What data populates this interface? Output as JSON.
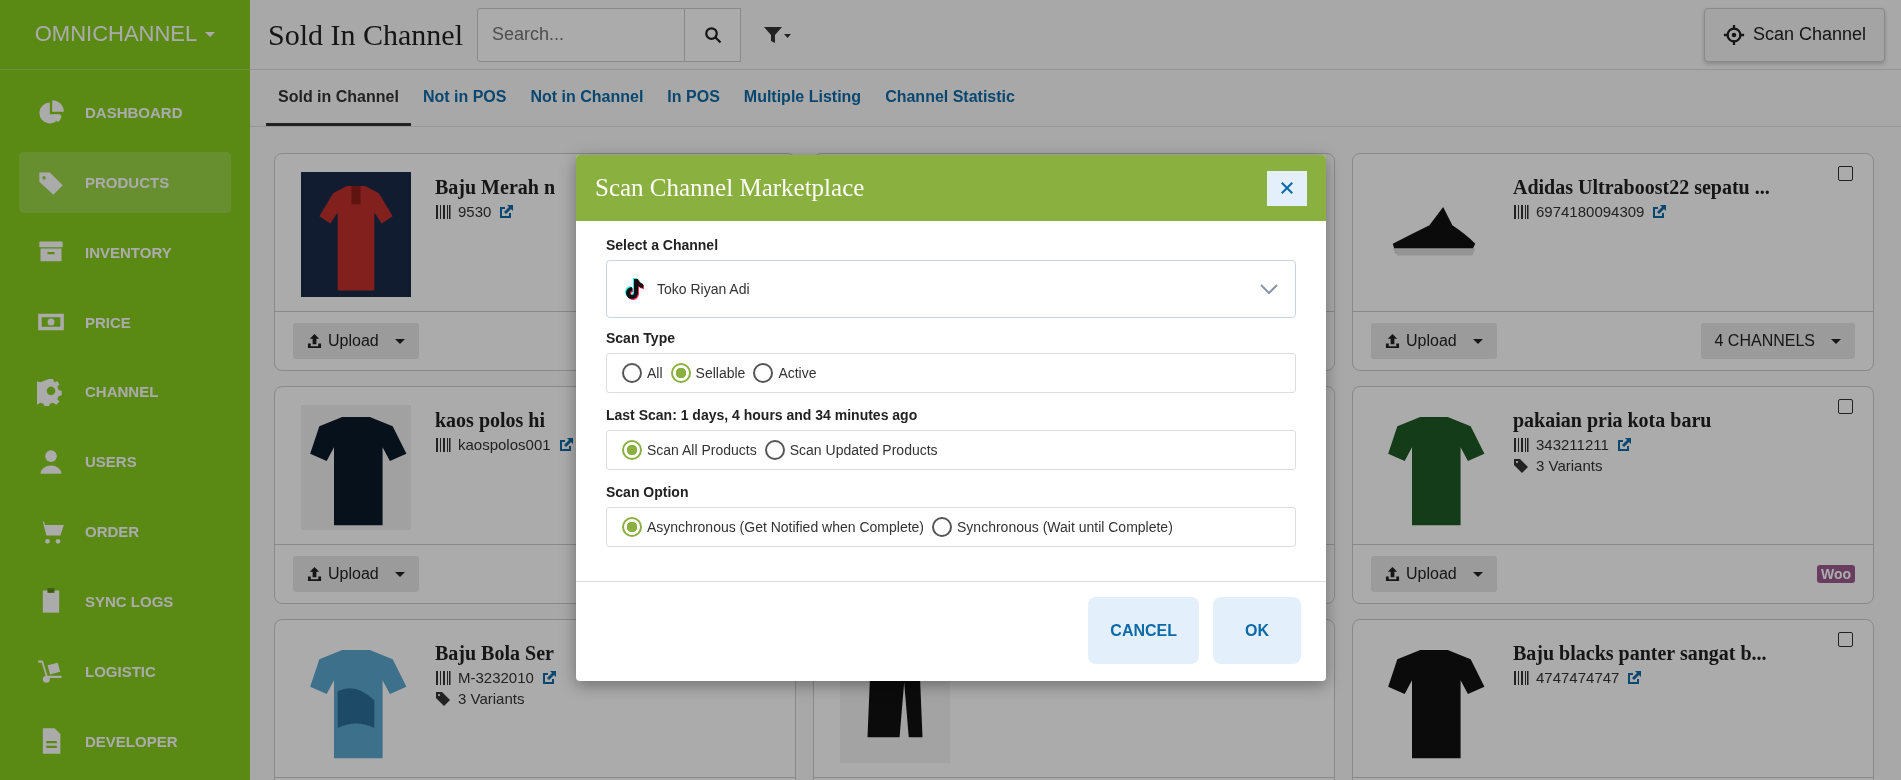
{
  "sidebar": {
    "brand": "OMNICHANNEL",
    "items": [
      {
        "label": "DASHBOARD",
        "selected": false
      },
      {
        "label": "PRODUCTS",
        "selected": true
      },
      {
        "label": "INVENTORY",
        "selected": false
      },
      {
        "label": "PRICE",
        "selected": false
      },
      {
        "label": "CHANNEL",
        "selected": false
      },
      {
        "label": "USERS",
        "selected": false
      },
      {
        "label": "ORDER",
        "selected": false
      },
      {
        "label": "SYNC LOGS",
        "selected": false
      },
      {
        "label": "LOGISTIC",
        "selected": false
      },
      {
        "label": "DEVELOPER",
        "selected": false
      }
    ]
  },
  "header": {
    "title": "Sold In Channel",
    "search": {
      "placeholder": "Search..."
    },
    "scan_button": "Scan Channel"
  },
  "tabs": [
    {
      "label": "Sold in Channel",
      "selected": true
    },
    {
      "label": "Not in POS",
      "selected": false
    },
    {
      "label": "Not in Channel",
      "selected": false
    },
    {
      "label": "In POS",
      "selected": false
    },
    {
      "label": "Multiple Listing",
      "selected": false
    },
    {
      "label": "Channel Statistic",
      "selected": false
    }
  ],
  "cards": [
    {
      "title": "Baju Merah n",
      "sku": "9530",
      "upload": "Upload"
    },
    {
      "title": "Adidas Ultraboost22 sepatu ...",
      "sku": "6974180094309",
      "upload": "Upload",
      "checked": false,
      "badge": {
        "kind": "channels",
        "label": "4 CHANNELS"
      }
    },
    {
      "title": "kaos polos hi",
      "sku": "kaospolos001",
      "upload": "Upload"
    },
    {
      "title": "pakaian pria kota baru",
      "sku": "343211211",
      "variants": "3 Variants",
      "upload": "Upload",
      "checked": false,
      "badge": {
        "kind": "woo",
        "label": "Woo"
      }
    },
    {
      "title": "Baju Bola Ser",
      "sku": "M-3232010",
      "variants": "3 Variants"
    },
    {
      "title": "Baju blacks panter sangat b...",
      "sku": "4747474747",
      "checked": false
    }
  ],
  "modal": {
    "title": "Scan Channel Marketplace",
    "channel": {
      "label": "Select a Channel",
      "value": "Toko Riyan Adi"
    },
    "groups": [
      {
        "label": "Scan Type",
        "options": [
          {
            "label": "All",
            "selected": false
          },
          {
            "label": "Sellable",
            "selected": true
          },
          {
            "label": "Active",
            "selected": false
          }
        ]
      },
      {
        "label": "Last Scan: 1 days, 4 hours and 34 minutes ago",
        "options": [
          {
            "label": "Scan All Products",
            "selected": true
          },
          {
            "label": "Scan Updated Products",
            "selected": false
          }
        ]
      },
      {
        "label": "Scan Option",
        "options": [
          {
            "label": "Asynchronous (Get Notified when Complete)",
            "selected": true
          },
          {
            "label": "Synchronous (Wait until Complete)",
            "selected": false
          }
        ]
      }
    ],
    "buttons": [
      "CANCEL",
      "OK"
    ]
  }
}
